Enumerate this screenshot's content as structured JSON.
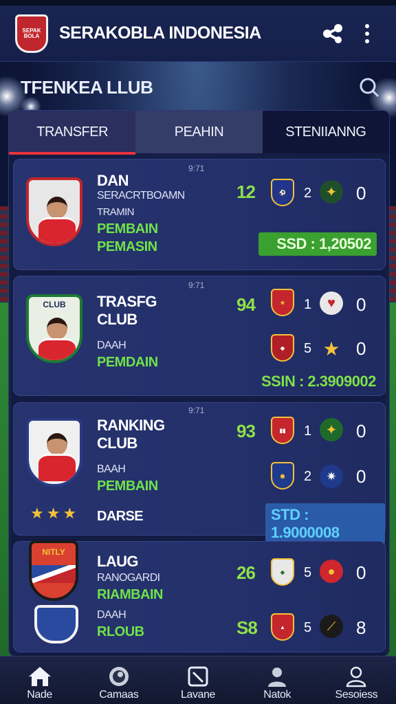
{
  "colors": {
    "accent_red": "#e8323c",
    "score_green": "#8fe04a",
    "label_green": "#6fe24a",
    "panel": "#141c42"
  },
  "app": {
    "logo_text": "SEPAK BOLA",
    "title": "SERAKOBLA INDONESIA",
    "share_icon": "share-icon",
    "menu_icon": "more-vertical-icon"
  },
  "section": {
    "title": "TFENKEA LLUB",
    "search_icon": "search-icon"
  },
  "tabs": [
    "TRANSFER",
    "PEAHIN",
    "STENIIANNG"
  ],
  "cards": [
    {
      "date": "9:71",
      "name": "DAN",
      "sub1": "SERACRTBOAMN",
      "sub2": "TRAMIN",
      "green1": "PEMBAIN",
      "green2": "PEMASIN",
      "crest_text": "",
      "score": "12",
      "row1": {
        "num": "2",
        "zero": "0"
      },
      "price": "SSD : 1,20502"
    },
    {
      "date": "9:71",
      "name": "TRASFG",
      "name2": "CLUB",
      "sub1": "DAAH",
      "green1": "PEMDAIN",
      "crest_text": "CLUB",
      "score": "94",
      "row1": {
        "num": "1",
        "zero": "0"
      },
      "row2": {
        "num": "5",
        "zero": "0"
      },
      "price": "SSIN : 2.3909002"
    },
    {
      "date": "9:71",
      "name": "RANKING",
      "name2": "CLUB",
      "sub1": "BAAH",
      "green1": "PEMBAIN",
      "extra": "DARSE",
      "score": "93",
      "row1": {
        "num": "1",
        "zero": "0"
      },
      "row2": {
        "num": "2",
        "zero": "0"
      },
      "price": "STD : 1.9000008"
    },
    {
      "name": "LAUG",
      "sub1": "RANOGARDI",
      "green1": "RIAMBAIN",
      "sub2": "DAAH",
      "green2": "RLOUB",
      "crest_text": "NITLY",
      "score": "26",
      "score2": "S8",
      "row1": {
        "num": "5",
        "zero": "0"
      },
      "row2": {
        "num": "5",
        "zero": "8"
      }
    }
  ],
  "nav": [
    {
      "label": "Nade",
      "icon": "home-icon"
    },
    {
      "label": "Camaas",
      "icon": "ball-icon"
    },
    {
      "label": "Lavane",
      "icon": "pitch-icon"
    },
    {
      "label": "Natok",
      "icon": "person-icon"
    },
    {
      "label": "Sesoiess",
      "icon": "user-icon"
    }
  ]
}
